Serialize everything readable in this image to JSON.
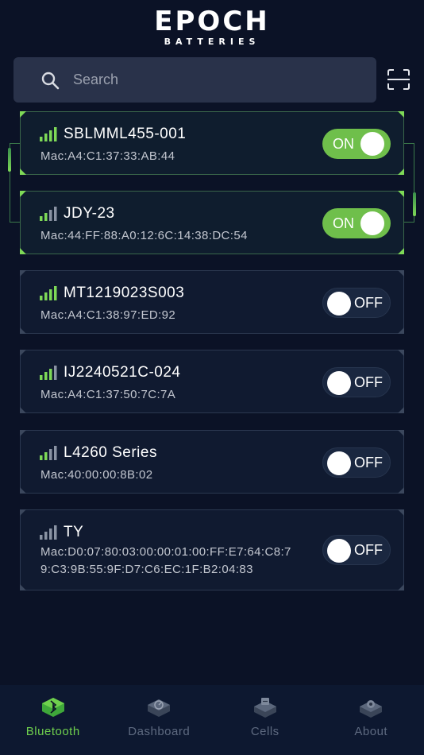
{
  "header": {
    "logo_main": "EP",
    "logo_mid": "O",
    "logo_end": "CH",
    "logo_sub": "BATTERIES"
  },
  "search": {
    "placeholder": "Search"
  },
  "devices": [
    {
      "name": "SBLMML455-001",
      "mac": "Mac:A4:C1:37:33:AB:44",
      "state": "ON"
    },
    {
      "name": "JDY-23",
      "mac": "Mac:44:FF:88:A0:12:6C:14:38:DC:54",
      "state": "ON"
    },
    {
      "name": "MT1219023S003",
      "mac": "Mac:A4:C1:38:97:ED:92",
      "state": "OFF"
    },
    {
      "name": "IJ2240521C-024",
      "mac": "Mac:A4:C1:37:50:7C:7A",
      "state": "OFF"
    },
    {
      "name": "L4260 Series",
      "mac": "Mac:40:00:00:8B:02",
      "state": "OFF"
    },
    {
      "name": "TY",
      "mac_line1": "Mac:D0:07:80:03:00:00:01:00:FF:E7:64:C8:7",
      "mac_line2": "9:C3:9B:55:9F:D7:C6:EC:1F:B2:04:83",
      "state": "OFF"
    }
  ],
  "nav": [
    {
      "label": "Bluetooth",
      "icon": "bluetooth-icon"
    },
    {
      "label": "Dashboard",
      "icon": "dashboard-icon"
    },
    {
      "label": "Cells",
      "icon": "cells-icon"
    },
    {
      "label": "About",
      "icon": "about-icon"
    }
  ],
  "colors": {
    "background": "#0b1226",
    "accent_green": "#6fbf4b",
    "card": "#101a30",
    "search_bg": "#29324a"
  }
}
